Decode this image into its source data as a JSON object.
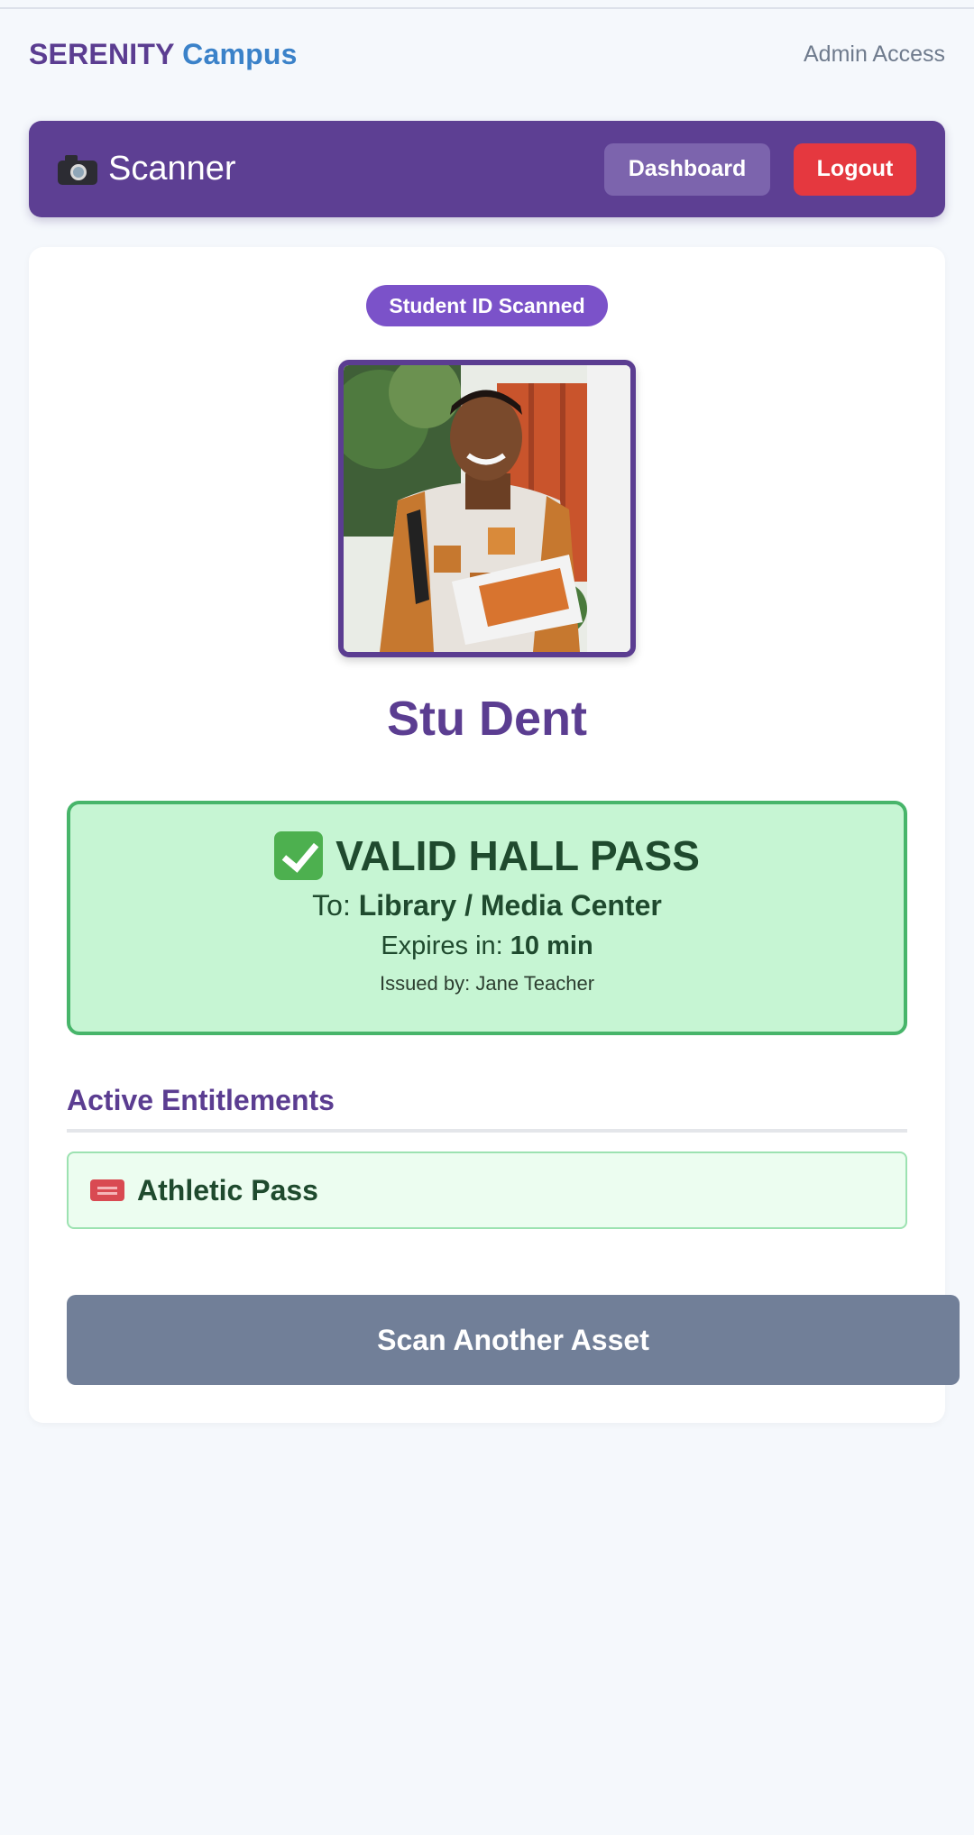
{
  "brand": {
    "part1": "SERENITY",
    "part2": "Campus"
  },
  "admin_link": "Admin Access",
  "header": {
    "title": "Scanner",
    "dashboard_label": "Dashboard",
    "logout_label": "Logout"
  },
  "scan": {
    "badge": "Student ID Scanned",
    "student_name": "Stu Dent"
  },
  "pass": {
    "title": "VALID HALL PASS",
    "to_label": "To:",
    "to_value": "Library / Media Center",
    "expires_label": "Expires in:",
    "expires_value": "10 min",
    "issued_by": "Issued by: Jane Teacher"
  },
  "entitlements": {
    "title": "Active Entitlements",
    "items": [
      {
        "label": "Athletic Pass",
        "icon": "ticket-icon"
      }
    ]
  },
  "scan_another_label": "Scan Another Asset",
  "colors": {
    "brand_purple": "#5b3d91",
    "brand_blue": "#3b82c9",
    "logout_red": "#e5383f",
    "valid_green_bg": "#c6f5d3",
    "valid_green_border": "#47b56a",
    "badge_purple": "#7b52c9",
    "scan_button_gray": "#717f98"
  }
}
